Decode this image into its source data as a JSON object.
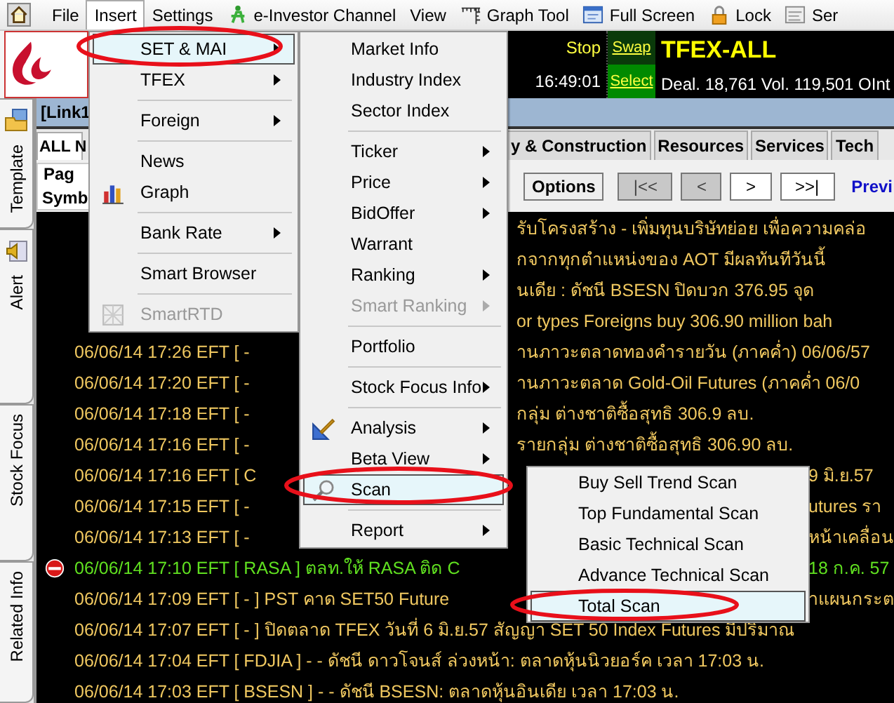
{
  "menubar": [
    {
      "label": "File",
      "kind": "home",
      "selected": false
    },
    {
      "label": "Insert",
      "kind": "text",
      "selected": true
    },
    {
      "label": "Settings",
      "kind": "text",
      "selected": false
    },
    {
      "label": "e-Investor Channel",
      "kind": "channel",
      "selected": false
    },
    {
      "label": "View",
      "kind": "text",
      "selected": false
    },
    {
      "label": "Graph Tool",
      "kind": "ruler",
      "selected": false
    },
    {
      "label": "Full Screen",
      "kind": "screen",
      "selected": false
    },
    {
      "label": "Lock",
      "kind": "lock",
      "selected": false
    },
    {
      "label": "Ser",
      "kind": "doc",
      "selected": false
    }
  ],
  "quote_panel": {
    "stop": "Stop",
    "time": "16:49:01",
    "swap": "Swap",
    "select": "Select",
    "symbol": "TFEX-ALL",
    "stats": "Deal. 18,761  Vol. 119,501    OInt"
  },
  "side_tabs": [
    {
      "label": "Template",
      "kind": "folder"
    },
    {
      "label": "Alert",
      "kind": "alert"
    },
    {
      "label": "Stock Focus",
      "kind": "text"
    },
    {
      "label": "Related Info",
      "kind": "text"
    }
  ],
  "link_bar": {
    "title": "[Link1"
  },
  "sector_tabs": [
    {
      "label": "ALL N",
      "selected": true
    },
    {
      "label": "y & Construction",
      "selected": false
    },
    {
      "label": "Resources",
      "selected": false
    },
    {
      "label": "Services",
      "selected": false
    },
    {
      "label": "Tech",
      "selected": false
    }
  ],
  "page_group": {
    "label": "Pag",
    "column": "Symb"
  },
  "toolbar": [
    {
      "label": "Options",
      "disabled": false
    },
    {
      "label": "|<<",
      "disabled": true
    },
    {
      "label": "<",
      "disabled": true
    },
    {
      "label": ">",
      "disabled": false
    },
    {
      "label": ">>|",
      "disabled": false
    }
  ],
  "toolbar_link": "Previ",
  "news": [
    {
      "after_menu": "รับโครงสร้าง - เพิ่มทุนบริษัทย่อย เพื่อความคล่อ",
      "highlighted": false
    },
    {
      "after_menu": "กจากทุกตำแหน่งของ AOT มีผลทันทีวันนี้",
      "highlighted": false
    },
    {
      "after_menu": "นเดีย :  ดัชนี BSESN  ปิดบวก   376.95 จุด",
      "highlighted": false
    },
    {
      "after_menu": "or types Foreigns buy 306.90 million bah",
      "highlighted": false
    },
    {
      "left": "06/06/14 17:26  EFT  [ -",
      "after_menu": "านภาวะตลาดทองคำรายวัน (ภาคค่ำ) 06/06/57",
      "highlighted": false
    },
    {
      "left": "06/06/14 17:20  EFT  [ -",
      "after_menu": "านภาวะตลาด Gold-Oil Futures (ภาคค่ำ 06/0",
      "highlighted": false
    },
    {
      "left": "06/06/14 17:18  EFT  [ -",
      "after_menu": "กลุ่ม ต่างชาติซื้อสุทธิ 306.9 ลบ.",
      "highlighted": false
    },
    {
      "left": "06/06/14 17:16  EFT  [ -",
      "after_menu": "รายกลุ่ม ต่างชาติซื้อสุทธิ 306.90 ลบ.",
      "highlighted": false
    },
    {
      "left": "06/06/14 17:16  EFT  [ C",
      "after_scan": "9 มิ.ย.57",
      "highlighted": false
    },
    {
      "left": "06/06/14 17:15  EFT  [ -",
      "after_scan": "utures รา",
      "highlighted": false
    },
    {
      "left": "06/06/14 17:13  EFT  [ -",
      "after_scan": "หน้าเคลื่อน",
      "highlighted": false
    },
    {
      "left": "06/06/14 17:10  EFT  [ RASA ]  ตลท.ให้ RASA ติด C",
      "after_scan": "18 ก.ค. 57",
      "highlighted": true
    },
    {
      "left": "06/06/14 17:09  EFT  [ - ]  PST คาด SET50 Future",
      "after_scan": "าแผนกระต",
      "highlighted": false
    },
    {
      "left": "06/06/14 17:07  EFT  [ - ]  ปิดตลาด TFEX วันที่ 6 มิ.ย.57 สัญญา SET 50 Index Futures มีปริมาณ",
      "highlighted": false
    },
    {
      "left": "06/06/14 17:04  EFT  [ FDJIA ]  - - ดัชนี ดาวโจนส์ ล่วงหน้า: ตลาดหุ้นนิวยอร์ค  เวลา 17:03 น.",
      "highlighted": false
    },
    {
      "left": "06/06/14 17:03  EFT  [ BSESN ]  - - ดัชนี BSESN: ตลาดหุ้นอินเดีย  เวลา 17:03 น.",
      "highlighted": false
    }
  ],
  "insert_menu": [
    {
      "kind": "item",
      "label": "SET & MAI",
      "submenu": true,
      "selected": true,
      "disabled": false
    },
    {
      "kind": "item",
      "label": "TFEX",
      "submenu": true,
      "selected": false,
      "disabled": false
    },
    {
      "kind": "separator"
    },
    {
      "kind": "item",
      "label": "Foreign",
      "submenu": true,
      "selected": false,
      "disabled": false
    },
    {
      "kind": "separator"
    },
    {
      "kind": "item",
      "label": "News",
      "submenu": false,
      "selected": false,
      "disabled": false
    },
    {
      "kind": "graph",
      "label": "Graph",
      "submenu": false,
      "selected": false,
      "disabled": false
    },
    {
      "kind": "separator"
    },
    {
      "kind": "item",
      "label": "Bank Rate",
      "submenu": true,
      "selected": false,
      "disabled": false
    },
    {
      "kind": "separator"
    },
    {
      "kind": "item",
      "label": "Smart Browser",
      "submenu": false,
      "selected": false,
      "disabled": false
    },
    {
      "kind": "separator"
    },
    {
      "kind": "grid",
      "label": "SmartRTD",
      "submenu": false,
      "selected": false,
      "disabled": true
    }
  ],
  "set_menu": [
    {
      "kind": "item",
      "label": "Market Info",
      "submenu": false,
      "selected": false,
      "disabled": false
    },
    {
      "kind": "item",
      "label": "Industry Index",
      "submenu": false,
      "selected": false,
      "disabled": false
    },
    {
      "kind": "item",
      "label": "Sector Index",
      "submenu": false,
      "selected": false,
      "disabled": false
    },
    {
      "kind": "separator"
    },
    {
      "kind": "item",
      "label": "Ticker",
      "submenu": true,
      "selected": false,
      "disabled": false
    },
    {
      "kind": "item",
      "label": "Price",
      "submenu": true,
      "selected": false,
      "disabled": false
    },
    {
      "kind": "item",
      "label": "BidOffer",
      "submenu": true,
      "selected": false,
      "disabled": false
    },
    {
      "kind": "item",
      "label": "Warrant",
      "submenu": false,
      "selected": false,
      "disabled": false
    },
    {
      "kind": "item",
      "label": "Ranking",
      "submenu": true,
      "selected": false,
      "disabled": false
    },
    {
      "kind": "item",
      "label": "Smart Ranking",
      "submenu": true,
      "selected": false,
      "disabled": true
    },
    {
      "kind": "separator"
    },
    {
      "kind": "item",
      "label": "Portfolio",
      "submenu": false,
      "selected": false,
      "disabled": false
    },
    {
      "kind": "separator"
    },
    {
      "kind": "item",
      "label": "Stock Focus Info",
      "submenu": true,
      "selected": false,
      "disabled": false
    },
    {
      "kind": "separator"
    },
    {
      "kind": "analysis",
      "label": "Analysis",
      "submenu": true,
      "selected": false,
      "disabled": false
    },
    {
      "kind": "item",
      "label": "Beta View",
      "submenu": true,
      "selected": false,
      "disabled": false
    },
    {
      "kind": "search",
      "label": "Scan",
      "submenu": false,
      "selected": true,
      "disabled": false
    },
    {
      "kind": "separator"
    },
    {
      "kind": "item",
      "label": "Report",
      "submenu": true,
      "selected": false,
      "disabled": false
    }
  ],
  "scan_menu": [
    {
      "label": "Buy Sell Trend Scan",
      "selected": false
    },
    {
      "label": "Top Fundamental Scan",
      "selected": false
    },
    {
      "label": "Basic Technical Scan",
      "selected": false
    },
    {
      "label": "Advance Technical Scan",
      "selected": false
    },
    {
      "label": "Total Scan",
      "selected": true
    }
  ],
  "annotation_marks": [
    {
      "color": "#e8101a"
    },
    {
      "color": "#e8101a"
    },
    {
      "color": "#e8101a"
    }
  ]
}
